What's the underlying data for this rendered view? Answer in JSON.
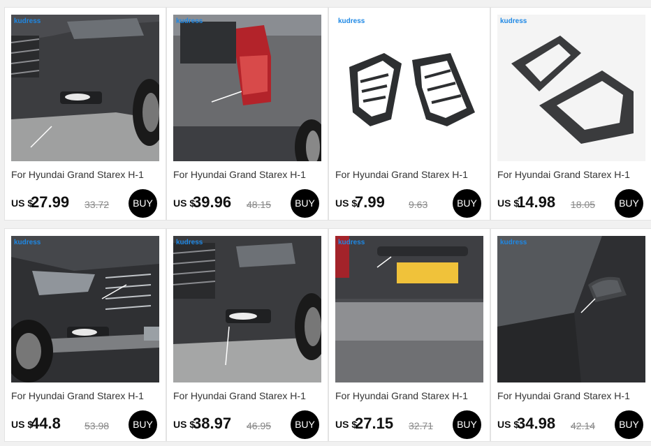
{
  "products": [
    {
      "title": "For Hyundai Grand Starex H-1",
      "currency": "US $",
      "price": "27.99",
      "old_price": "33.72",
      "buy_label": "BUY",
      "brand": "kudress"
    },
    {
      "title": "For Hyundai Grand Starex H-1",
      "currency": "US $",
      "price": "39.96",
      "old_price": "48.15",
      "buy_label": "BUY",
      "brand": "kudress"
    },
    {
      "title": "For Hyundai Grand Starex H-1",
      "currency": "US $",
      "price": "7.99",
      "old_price": "9.63",
      "buy_label": "BUY",
      "brand": "kudress"
    },
    {
      "title": "For Hyundai Grand Starex H-1",
      "currency": "US $",
      "price": "14.98",
      "old_price": "18.05",
      "buy_label": "BUY",
      "brand": "kudress"
    },
    {
      "title": "For Hyundai Grand Starex H-1",
      "currency": "US $",
      "price": "44.8",
      "old_price": "53.98",
      "buy_label": "BUY",
      "brand": "kudress"
    },
    {
      "title": "For Hyundai Grand Starex H-1",
      "currency": "US $",
      "price": "38.97",
      "old_price": "46.95",
      "buy_label": "BUY",
      "brand": "kudress"
    },
    {
      "title": "For Hyundai Grand Starex H-1",
      "currency": "US $",
      "price": "27.15",
      "old_price": "32.71",
      "buy_label": "BUY",
      "brand": "kudress"
    },
    {
      "title": "For Hyundai Grand Starex H-1",
      "currency": "US $",
      "price": "34.98",
      "old_price": "42.14",
      "buy_label": "BUY",
      "brand": "kudress"
    }
  ],
  "colors": {
    "buy_button": "#000000",
    "brand_blue": "#1e88e5",
    "background": "#f1f1f1"
  }
}
